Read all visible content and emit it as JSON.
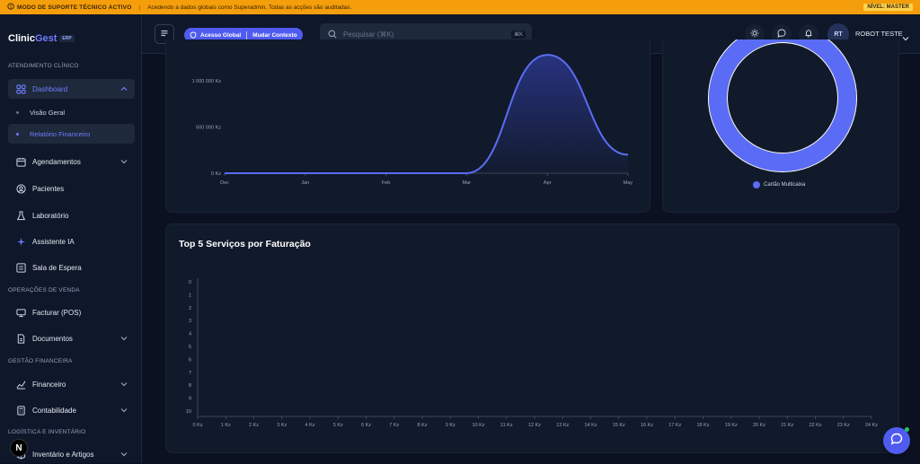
{
  "banner": {
    "title": "MODO DE SUPORTE TÉCNICO ACTIVO",
    "message": "Acedendo a dados globais como Superadmin. Todas as acções são auditadas.",
    "level": "NÍVEL: MASTER"
  },
  "brand": {
    "name_a": "Clinic",
    "name_b": "Gest",
    "tag": "ERP"
  },
  "sidebar": {
    "sections": [
      "ATENDIMENTO CLÍNICO",
      "OPERAÇÕES DE VENDA",
      "GESTÃO FINANCEIRA",
      "LOGÍSTICA E INVENTÁRIO"
    ],
    "items": {
      "dashboard": "Dashboard",
      "visao_geral": "Visão Geral",
      "relatorio": "Relatório Financeiro",
      "agendamentos": "Agendamentos",
      "pacientes": "Pacientes",
      "laboratorio": "Laboratório",
      "assistente": "Assistente IA",
      "sala": "Sala de Espera",
      "facturar": "Facturar (POS)",
      "documentos": "Documentos",
      "financeiro": "Financeiro",
      "contabilidade": "Contabilidade",
      "inventario": "Inventário e Artigos"
    },
    "badge": "N"
  },
  "topbar": {
    "context_global": "Acesso Global",
    "context_switch": "Mudar Contexto",
    "search_placeholder": "Pesquisar (⌘K)",
    "search_kbd": "⌘K",
    "avatar_initials": "RT",
    "user_name": "ROBOT TESTE"
  },
  "colors": {
    "accent": "#5a6cf5",
    "banner": "#f59e0b",
    "bg": "#0b1120",
    "card": "#111a2b"
  },
  "chart_data": [
    {
      "type": "area",
      "x": [
        "Dec",
        "Jan",
        "Feb",
        "Mar",
        "Apr",
        "May"
      ],
      "y_ticks": [
        "0 Kz",
        "500 000 Kz",
        "1 000 000 Kz"
      ],
      "values": [
        0,
        0,
        0,
        0,
        1280000,
        200000
      ],
      "ylim": [
        0,
        1000000
      ]
    },
    {
      "type": "pie",
      "labels": [
        "Cartão Multicaixa"
      ],
      "values": [
        100
      ]
    },
    {
      "type": "bar",
      "title": "Top 5 Serviços por Faturação",
      "categories": [
        "0",
        "1",
        "2",
        "3",
        "4",
        "5",
        "6",
        "7",
        "8",
        "9",
        "10"
      ],
      "values": [],
      "x_ticks": [
        "0 Kz",
        "1 Kz",
        "2 Kz",
        "3 Kz",
        "4 Kz",
        "5 Kz",
        "6 Kz",
        "7 Kz",
        "8 Kz",
        "9 Kz",
        "10 Kz",
        "11 Kz",
        "12 Kz",
        "13 Kz",
        "14 Kz",
        "15 Kz",
        "16 Kz",
        "17 Kz",
        "18 Kz",
        "19 Kz",
        "20 Kz",
        "21 Kz",
        "22 Kz",
        "23 Kz",
        "24 Kz"
      ],
      "xlim": [
        0,
        24
      ]
    }
  ]
}
